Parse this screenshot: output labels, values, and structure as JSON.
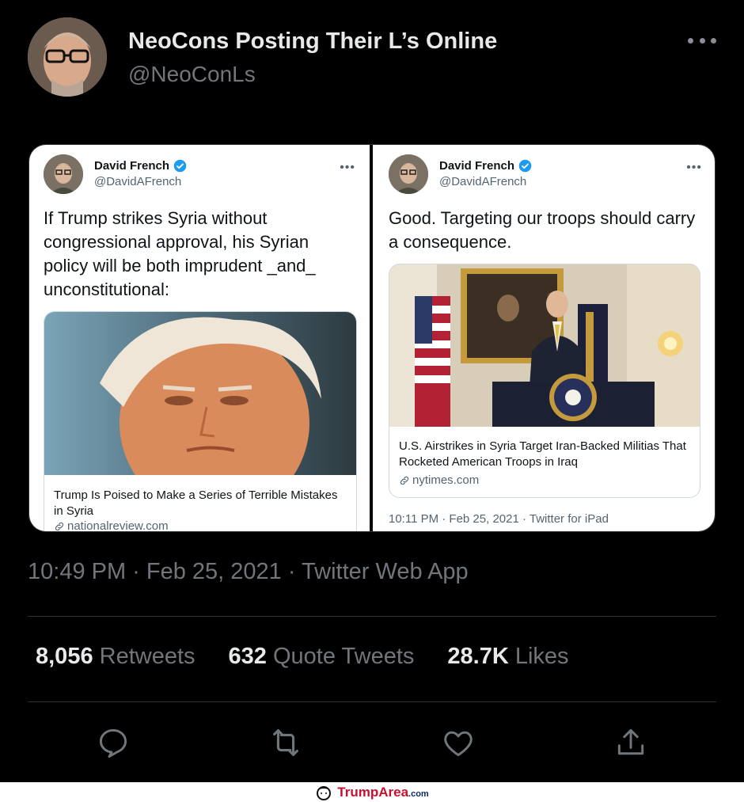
{
  "author": {
    "display_name": "NeoCons Posting Their L’s Online",
    "handle": "@NeoConLs"
  },
  "media": {
    "left_tweet": {
      "name": "David French",
      "handle": "@DavidAFrench",
      "text": "If Trump strikes Syria without congressional approval, his Syrian policy will be both imprudent _and_ unconstitutional:",
      "card_title": "Trump Is Poised to Make a Series of Terrible Mistakes in Syria",
      "card_domain": "nationalreview.com"
    },
    "right_tweet": {
      "name": "David French",
      "handle": "@DavidAFrench",
      "text": "Good. Targeting our troops should carry a consequence.",
      "card_title": "U.S. Airstrikes in Syria Target Iran-Backed Militias That Rocketed American Troops in Iraq",
      "card_domain": "nytimes.com",
      "meta": "10:11 PM · Feb 25, 2021 · Twitter for iPad"
    }
  },
  "timestamp": "10:49 PM · Feb 25, 2021 · Twitter Web App",
  "stats": {
    "retweets_count": "8,056",
    "retweets_label": "Retweets",
    "quotes_count": "632",
    "quotes_label": "Quote Tweets",
    "likes_count": "28.7K",
    "likes_label": "Likes"
  },
  "actions": [
    "reply-icon",
    "retweet-icon",
    "like-icon",
    "share-icon"
  ],
  "footer": {
    "brand": "TrumpArea",
    "tld": ".com"
  },
  "colors": {
    "background": "#000000",
    "verified": "#1d9bf0",
    "secondary_text": "#71767b",
    "brand_red": "#c8102e"
  }
}
